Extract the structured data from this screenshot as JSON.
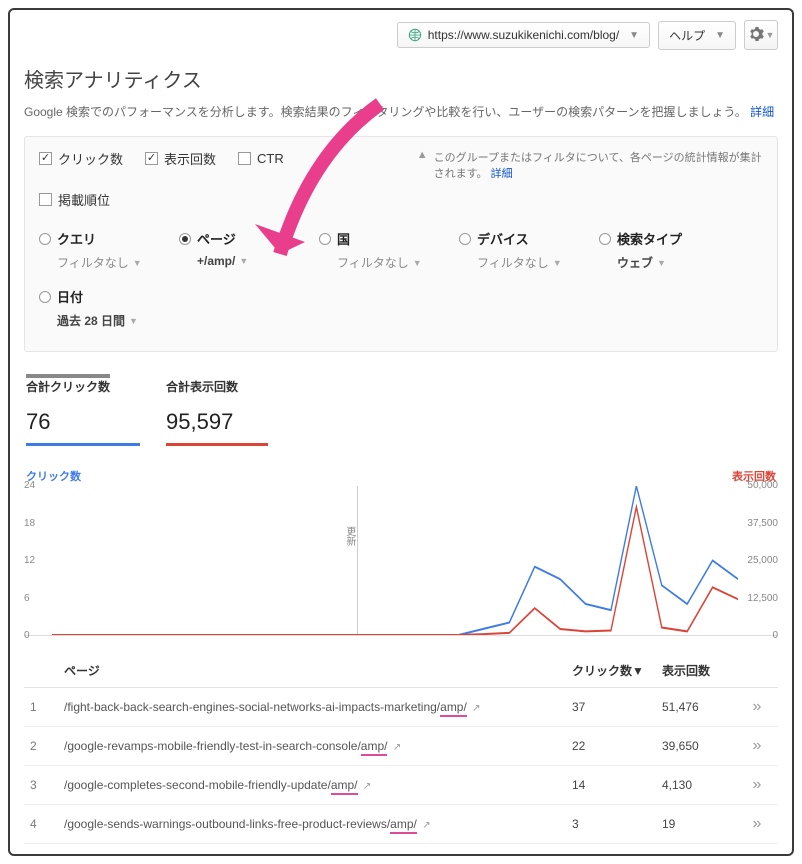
{
  "header": {
    "site_url": "https://www.suzukikenichi.com/blog/",
    "help_label": "ヘルプ"
  },
  "title": "検索アナリティクス",
  "subtitle": "Google 検索でのパフォーマンスを分析します。検索結果のフィルタリングや比較を行い、ユーザーの検索パターンを把握しましょう。",
  "subtitle_link": "詳細",
  "metrics": {
    "clicks": {
      "label": "クリック数",
      "checked": true
    },
    "impressions": {
      "label": "表示回数",
      "checked": true
    },
    "ctr": {
      "label": "CTR",
      "checked": false
    },
    "position": {
      "label": "掲載順位",
      "checked": false
    }
  },
  "notice": {
    "text": "このグループまたはフィルタについて、各ページの統計情報が集計されます。",
    "link": "詳細"
  },
  "dimensions": {
    "query": {
      "label": "クエリ",
      "filter": "フィルタなし",
      "selected": false
    },
    "page": {
      "label": "ページ",
      "filter": "+/amp/",
      "selected": true
    },
    "country": {
      "label": "国",
      "filter": "フィルタなし",
      "selected": false
    },
    "device": {
      "label": "デバイス",
      "filter": "フィルタなし",
      "selected": false
    },
    "searchtype": {
      "label": "検索タイプ",
      "filter": "ウェブ",
      "selected": false
    },
    "date": {
      "label": "日付",
      "filter": "過去 28 日間",
      "selected": false
    }
  },
  "totals": {
    "clicks": {
      "label": "合計クリック数",
      "value": "76"
    },
    "impressions": {
      "label": "合計表示回数",
      "value": "95,597"
    }
  },
  "chart_data": {
    "type": "line",
    "left_axis_label": "クリック数",
    "right_axis_label": "表示回数",
    "y_left": {
      "ticks": [
        0,
        6,
        12,
        18,
        24
      ],
      "max": 24
    },
    "y_right": {
      "ticks": [
        0,
        12500,
        25000,
        37500,
        50000
      ],
      "max": 50000
    },
    "x_count": 28,
    "update_marker": {
      "label": "更新",
      "x_index": 12
    },
    "series": [
      {
        "name": "クリック数",
        "axis": "left",
        "color": "#3f7be8",
        "values": [
          0,
          0,
          0,
          0,
          0,
          0,
          0,
          0,
          0,
          0,
          0,
          0,
          0,
          0,
          0,
          0,
          0,
          1,
          2,
          11,
          9,
          5,
          4,
          24,
          8,
          5,
          12,
          9
        ]
      },
      {
        "name": "表示回数",
        "axis": "right",
        "color": "#db4437",
        "values": [
          0,
          0,
          0,
          0,
          0,
          0,
          0,
          0,
          0,
          0,
          0,
          0,
          0,
          0,
          0,
          0,
          0,
          300,
          700,
          9000,
          2000,
          1200,
          1500,
          43000,
          2500,
          1200,
          16000,
          12000
        ]
      }
    ]
  },
  "table": {
    "headers": {
      "page": "ページ",
      "clicks": "クリック数▼",
      "impressions": "表示回数"
    },
    "rows": [
      {
        "idx": "1",
        "url": "/fight-back-back-search-engines-social-networks-ai-impacts-marketing/",
        "amp": "amp/",
        "clicks": "37",
        "impressions": "51,476"
      },
      {
        "idx": "2",
        "url": "/google-revamps-mobile-friendly-test-in-search-console/",
        "amp": "amp/",
        "clicks": "22",
        "impressions": "39,650"
      },
      {
        "idx": "3",
        "url": "/google-completes-second-mobile-friendly-update/",
        "amp": "amp/",
        "clicks": "14",
        "impressions": "4,130"
      },
      {
        "idx": "4",
        "url": "/google-sends-warnings-outbound-links-free-product-reviews/",
        "amp": "amp/",
        "clicks": "3",
        "impressions": "19"
      }
    ]
  }
}
